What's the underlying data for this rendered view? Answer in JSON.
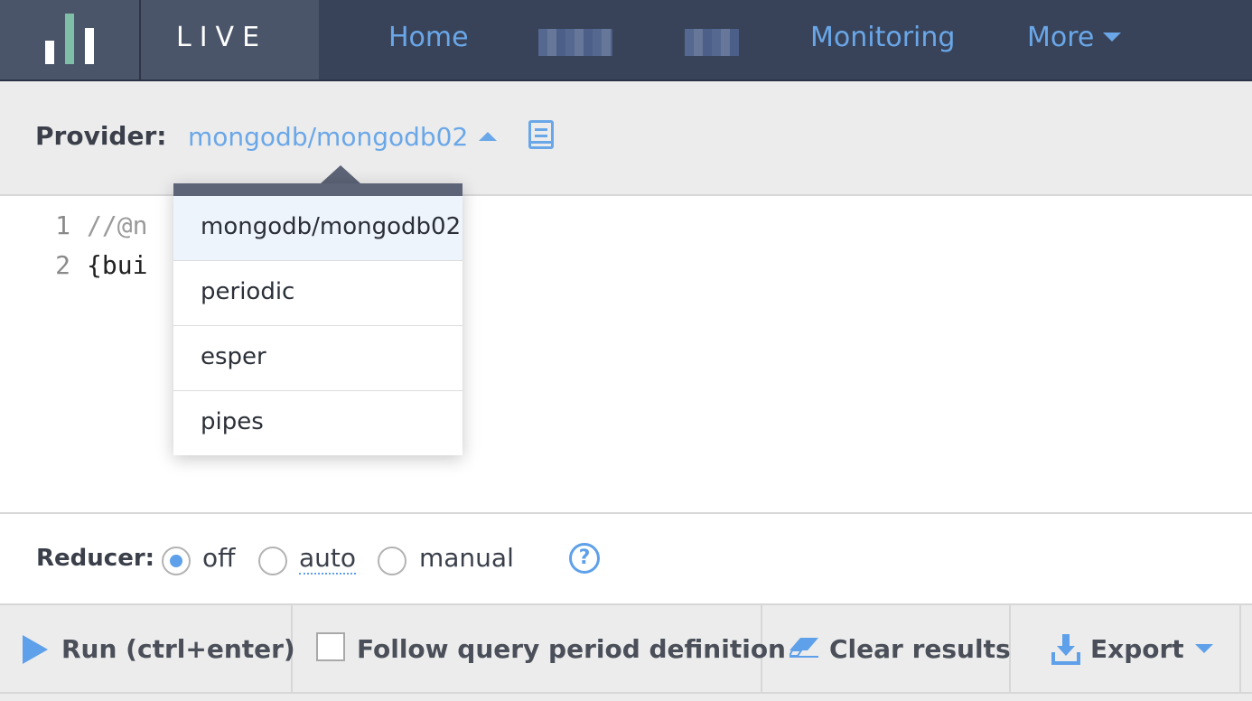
{
  "nav": {
    "brand": "LIVE",
    "items": [
      {
        "label": "Home"
      },
      {
        "label": "Monitoring"
      },
      {
        "label": "More"
      }
    ]
  },
  "provider": {
    "label": "Provider:",
    "selected": "mongodb/mongodb02",
    "options": [
      "mongodb/mongodb02",
      "periodic",
      "esper",
      "pipes"
    ]
  },
  "editor": {
    "lines": [
      {
        "num": "1",
        "text": "//@n"
      },
      {
        "num": "2",
        "text": "{bui"
      }
    ]
  },
  "reducer": {
    "label": "Reducer:",
    "options": [
      {
        "label": "off",
        "checked": true
      },
      {
        "label": "auto",
        "checked": false
      },
      {
        "label": "manual",
        "checked": false
      }
    ],
    "help": "?"
  },
  "actions": {
    "run": "Run  (ctrl+enter)",
    "follow": "Follow query period definition",
    "clear": "Clear results",
    "export": "Export"
  },
  "colors": {
    "nav_bg": "#384359",
    "accent": "#5ea0e9",
    "link": "#6aa7e8"
  }
}
